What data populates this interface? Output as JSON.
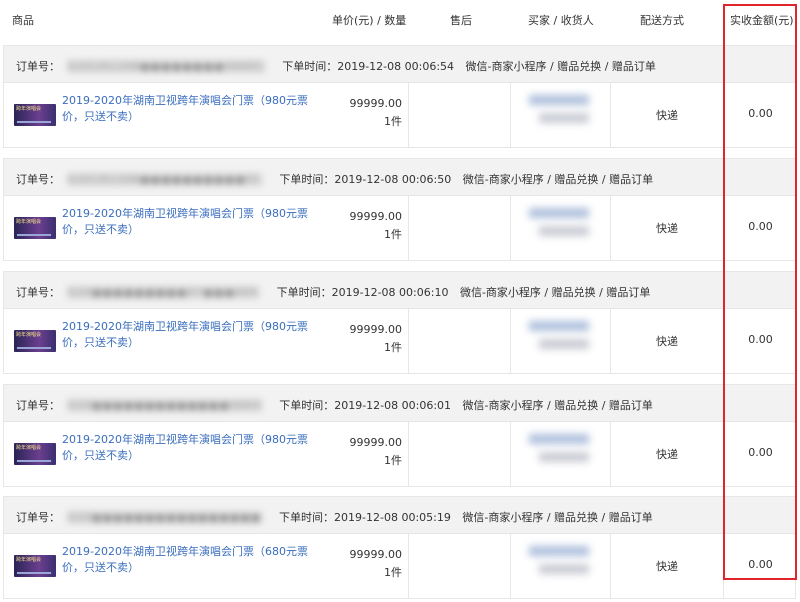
{
  "header": {
    "goods": "商品",
    "price_qty": "单价(元) / 数量",
    "after_sale": "售后",
    "buyer": "买家 / 收货人",
    "shipping": "配送方式",
    "total": "实收金额(元)"
  },
  "orders": [
    {
      "order_label": "订单号：",
      "order_no": "E20191208●●●●●●●●00001",
      "time_label": "下单时间：",
      "time": "2019-12-08 00:06:54",
      "source": "微信-商家小程序 / 赠品兑换 / 赠品订单",
      "product_name": "2019-2020年湖南卫视跨年演唱会门票（980元票价，只送不卖）",
      "price": "99999.00",
      "qty": "1件",
      "shipping": "快递",
      "total": "0.00"
    },
    {
      "order_label": "订单号：",
      "order_no": "E20191208●●●●●●●●●●01",
      "time_label": "下单时间：",
      "time": "2019-12-08 00:06:50",
      "source": "微信-商家小程序 / 赠品兑换 / 赠品订单",
      "product_name": "2019-2020年湖南卫视跨年演唱会门票（980元票价，只送不卖）",
      "price": "99999.00",
      "qty": "1件",
      "shipping": "快递",
      "total": "0.00"
    },
    {
      "order_label": "订单号：",
      "order_no": "E20●●●●●●●●●07●●●005",
      "time_label": "下单时间：",
      "time": "2019-12-08 00:06:10",
      "source": "微信-商家小程序 / 赠品兑换 / 赠品订单",
      "product_name": "2019-2020年湖南卫视跨年演唱会门票（980元票价，只送不卖）",
      "price": "99999.00",
      "qty": "1件",
      "shipping": "快递",
      "total": "0.00"
    },
    {
      "order_label": "订单号：",
      "order_no": "E20●●●●●●●●●●●●●0003",
      "time_label": "下单时间：",
      "time": "2019-12-08 00:06:01",
      "source": "微信-商家小程序 / 赠品兑换 / 赠品订单",
      "product_name": "2019-2020年湖南卫视跨年演唱会门票（980元票价，只送不卖）",
      "price": "99999.00",
      "qty": "1件",
      "shipping": "快递",
      "total": "0.00"
    },
    {
      "order_label": "订单号：",
      "order_no": "E20●●●●●●●●●●●●●●●●",
      "time_label": "下单时间：",
      "time": "2019-12-08 00:05:19",
      "source": "微信-商家小程序 / 赠品兑换 / 赠品订单",
      "product_name": "2019-2020年湖南卫视跨年演唱会门票（680元票价，只送不卖）",
      "price": "99999.00",
      "qty": "1件",
      "shipping": "快递",
      "total": "0.00"
    }
  ],
  "thumbnail_caption": "跨年演唱会",
  "colors": {
    "link": "#3a6ebd",
    "order_head_bg": "#f2f2f2",
    "highlight": "#e0252b",
    "thumbnail_bg": "#2a2456"
  }
}
